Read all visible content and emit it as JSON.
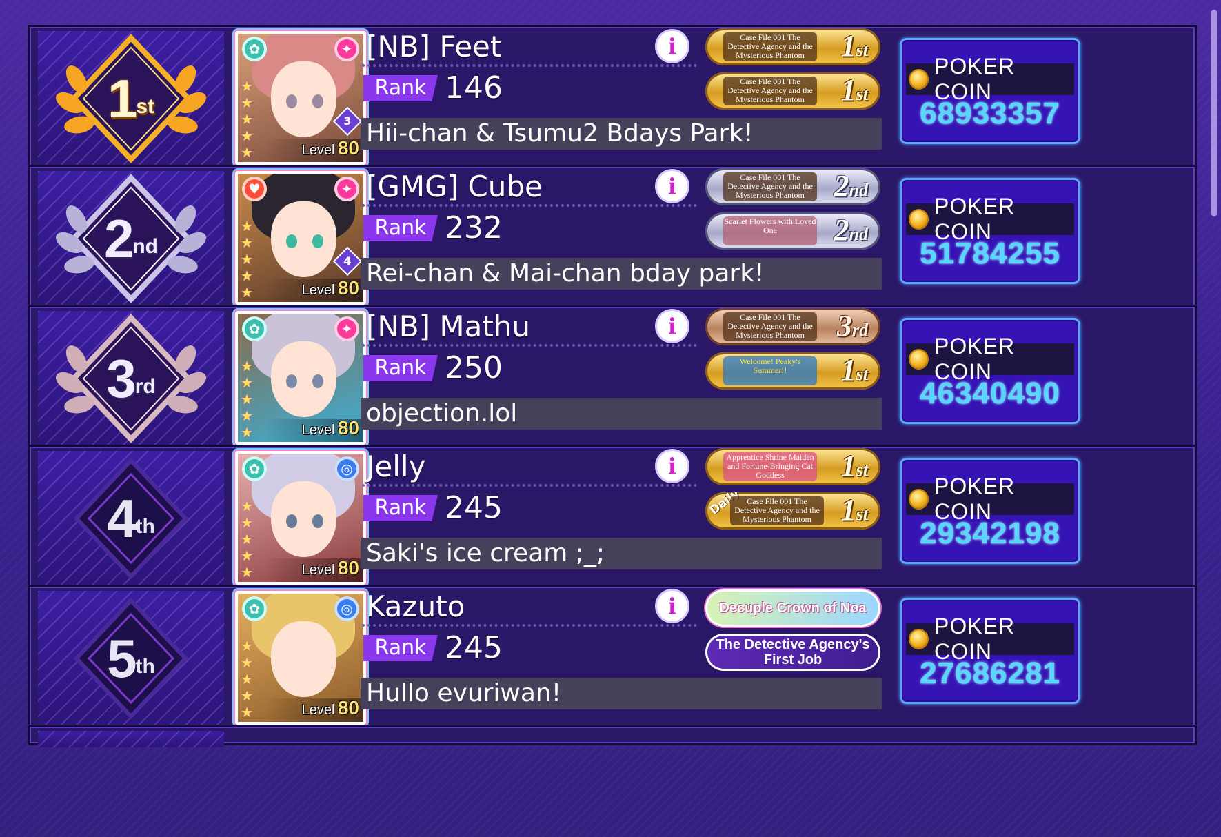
{
  "colors": {
    "background": "#3a1f86",
    "row_background": "#2a1768",
    "rank_tag": "#8a37ee",
    "coin_value": "#58d6ff",
    "info_icon": "#d21fd0"
  },
  "coin_label": "POKER COIN",
  "rank_label": "Rank",
  "level_label": "Level",
  "rows": [
    {
      "place_num": "1",
      "place_suffix": "st",
      "name": "[NB] Feet",
      "rank": "146",
      "comment": "Hii-chan & Tsumu2 Bdays Park!",
      "level": "80",
      "mastery": "3",
      "coins": "68933357",
      "badges": [
        {
          "event_text": "Case File 001 The Detective Agency and the Mysterious Phantom",
          "place": "1",
          "suffix": "st"
        },
        {
          "event_text": "Case File 001 The Detective Agency and the Mysterious Phantom",
          "place": "1",
          "suffix": "st"
        }
      ]
    },
    {
      "place_num": "2",
      "place_suffix": "nd",
      "name": "[GMG] Cube",
      "rank": "232",
      "comment": "Rei-chan & Mai-chan bday park!",
      "level": "80",
      "mastery": "4",
      "coins": "51784255",
      "badges": [
        {
          "event_text": "Case File 001 The Detective Agency and the Mysterious Phantom",
          "place": "2",
          "suffix": "nd"
        },
        {
          "event_text": "Scarlet Flowers with Loved One",
          "place": "2",
          "suffix": "nd"
        }
      ]
    },
    {
      "place_num": "3",
      "place_suffix": "rd",
      "name": "[NB] Mathu",
      "rank": "250",
      "comment": "objection.lol",
      "level": "80",
      "coins": "46340490",
      "badges": [
        {
          "event_text": "Case File 001 The Detective Agency and the Mysterious Phantom",
          "place": "3",
          "suffix": "rd"
        },
        {
          "event_text": "Welcome! Peaky's Summer!!",
          "place": "1",
          "suffix": "st"
        }
      ]
    },
    {
      "place_num": "4",
      "place_suffix": "th",
      "name": "Jelly",
      "rank": "245",
      "comment": "Saki's ice cream ;_;",
      "level": "80",
      "coins": "29342198",
      "badges": [
        {
          "event_text": "Apprentice Shrine Maiden and Fortune-Bringing Cat Goddess",
          "place": "1",
          "suffix": "st"
        },
        {
          "daily": "Daily",
          "event_text": "Case File 001 The Detective Agency and the Mysterious Phantom",
          "place": "1",
          "suffix": "st"
        }
      ]
    },
    {
      "place_num": "5",
      "place_suffix": "th",
      "name": "Kazuto",
      "rank": "245",
      "comment": "Hullo evuriwan!",
      "level": "80",
      "coins": "27686281",
      "badges": [
        {
          "title": "Decuple Crown of Noa"
        },
        {
          "title": "The Detective Agency's First Job"
        }
      ]
    }
  ]
}
